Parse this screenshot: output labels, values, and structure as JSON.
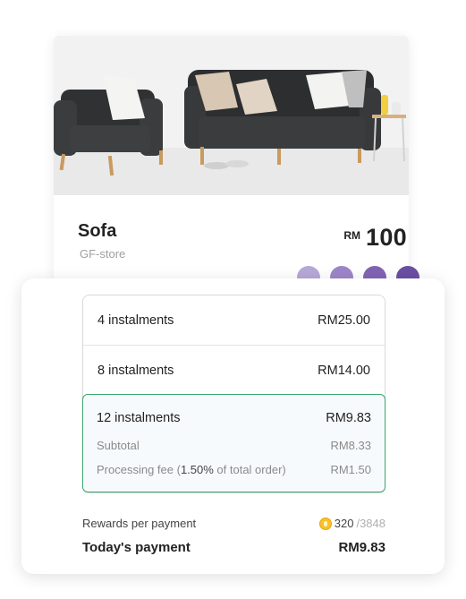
{
  "product": {
    "name": "Sofa",
    "store": "GF-store",
    "currency": "RM",
    "amount": "100"
  },
  "colors": {
    "dots": [
      "#b7a8d8",
      "#9d86c8",
      "#8064b4",
      "#6a4fa3"
    ],
    "selected_border": "#3aa76d"
  },
  "instalments": {
    "options": [
      {
        "label": "4 instalments",
        "amount": "RM25.00"
      },
      {
        "label": "8 instalments",
        "amount": "RM14.00"
      }
    ],
    "selected": {
      "label": "12 instalments",
      "amount": "RM9.83",
      "subtotal_label": "Subtotal",
      "subtotal_value": "RM8.33",
      "fee_label_prefix": "Processing fee (",
      "fee_rate": "1.50%",
      "fee_label_suffix": " of total order)",
      "fee_value": "RM1.50"
    }
  },
  "rewards": {
    "label": "Rewards per payment",
    "icon": "coin-icon",
    "current": "320",
    "total": "/3848"
  },
  "today": {
    "label": "Today's payment",
    "value": "RM9.83"
  }
}
